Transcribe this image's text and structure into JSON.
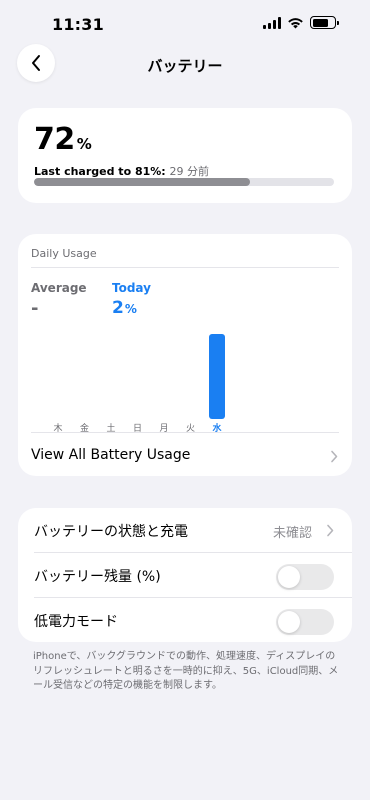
{
  "status_bar": {
    "time": "11:31",
    "battery_fill": 0.72
  },
  "nav": {
    "title": "バッテリー",
    "back_icon": "chevron-left-icon"
  },
  "level": {
    "value": "72",
    "unit": "%",
    "last_charged_label": "Last charged to 81%:",
    "last_charged_ago": "29 分前",
    "progress_fraction": 0.72
  },
  "usage": {
    "title": "Daily Usage",
    "average_label": "Average",
    "average_value": "-",
    "today_label": "Today",
    "today_value": "2",
    "today_unit": "%",
    "view_all_label": "View All Battery Usage"
  },
  "chart_data": {
    "type": "bar",
    "categories": [
      "木",
      "金",
      "土",
      "日",
      "月",
      "火",
      "水"
    ],
    "values": [
      0,
      0,
      0,
      0,
      0,
      0,
      2
    ],
    "highlight": "水",
    "highlight_color": "#1a7ff2"
  },
  "settings": {
    "rows": [
      {
        "label": "バッテリーの状態と充電",
        "value": "未確認"
      },
      {
        "label": "バッテリー残量 (%)",
        "toggle_on": false
      },
      {
        "label": "低電力モード",
        "toggle_on": false
      }
    ]
  },
  "footnote": "iPhoneで、バックグラウンドでの動作、処理速度、ディスプレイのリフレッシュレートと明るさを一時的に抑え、5G、iCloud同期、メール受信などの特定の機能を制限します。",
  "colors": {
    "background": "#f2f2f7",
    "accent": "#1a7ff2",
    "secondary_text": "#6d6d72"
  }
}
